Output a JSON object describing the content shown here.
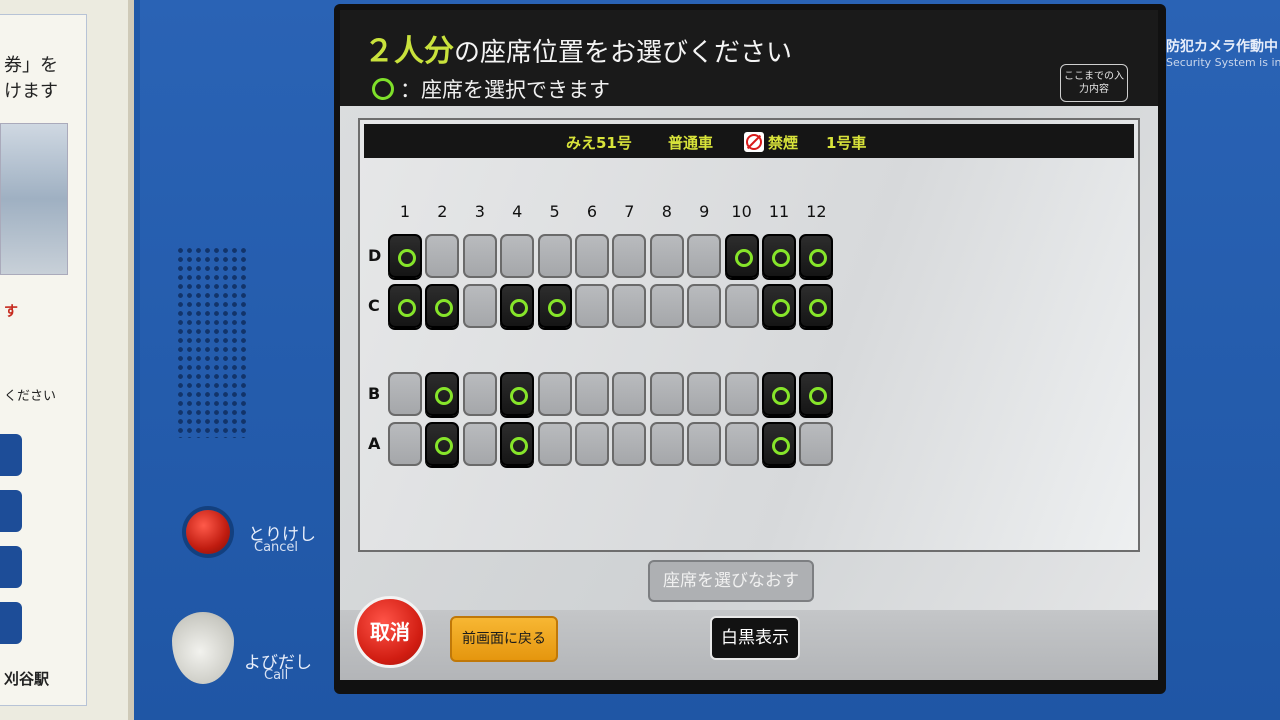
{
  "left_panel": {
    "line1": "券」を",
    "line2": "けます",
    "red_text": "す",
    "small_text": "ください",
    "station": "刈谷駅"
  },
  "hardware": {
    "cancel_label": "とりけし",
    "cancel_sub": "Cancel",
    "call_label": "よびだし",
    "call_sub": "Call",
    "security_jp": "防犯カメラ作動中",
    "security_en": "Security System is in O"
  },
  "screen": {
    "title_highlight": "２人分",
    "title_rest": "の座席位置をお選びください",
    "legend_text": "：座席を選択できます",
    "history_button": "ここまでの入力内容",
    "car": {
      "train_name": "みえ51号",
      "class": "普通車",
      "smoking": "禁煙",
      "car_number": "1号車"
    },
    "columns": [
      "1",
      "2",
      "3",
      "4",
      "5",
      "6",
      "7",
      "8",
      "9",
      "10",
      "11",
      "12"
    ],
    "rows": [
      {
        "label": "D",
        "available": [
          true,
          false,
          false,
          false,
          false,
          false,
          false,
          false,
          false,
          true,
          true,
          true
        ]
      },
      {
        "label": "C",
        "available": [
          true,
          true,
          false,
          true,
          true,
          false,
          false,
          false,
          false,
          false,
          true,
          true
        ]
      },
      {
        "label": "B",
        "available": [
          false,
          true,
          false,
          true,
          false,
          false,
          false,
          false,
          false,
          false,
          true,
          true
        ]
      },
      {
        "label": "A",
        "available": [
          false,
          true,
          false,
          true,
          false,
          false,
          false,
          false,
          false,
          false,
          true,
          false
        ]
      }
    ],
    "redo_button": "座席を選びなおす",
    "cancel_button": "取消",
    "back_button": "前画面に戻る",
    "mono_button": "白黒表示"
  }
}
